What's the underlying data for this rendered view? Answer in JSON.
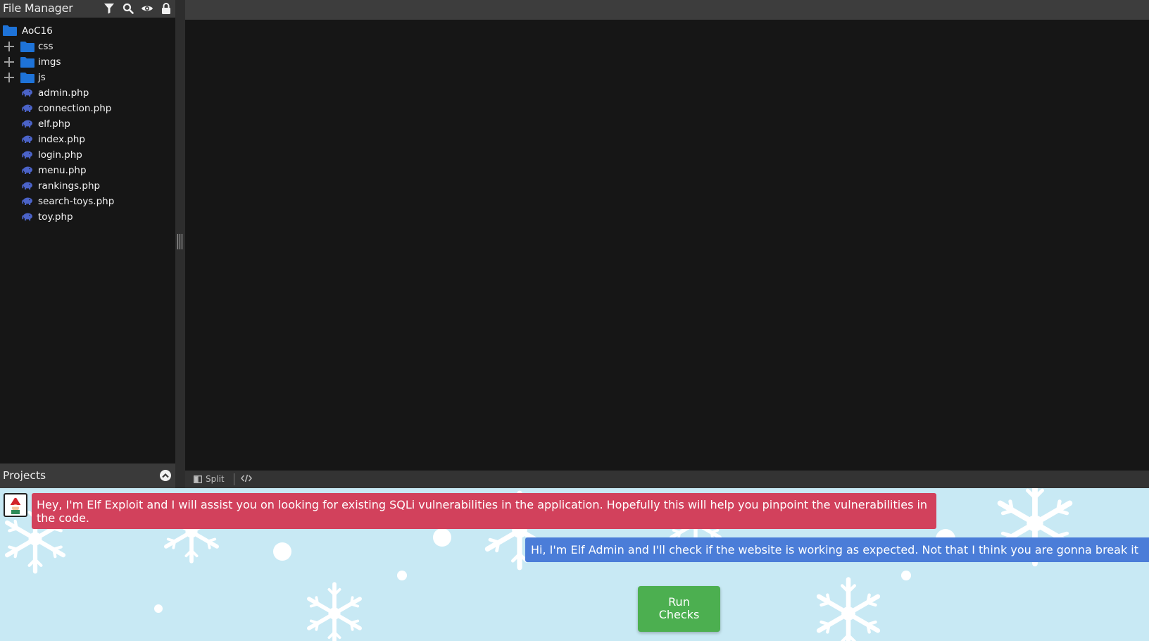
{
  "sidebar": {
    "title": "File Manager",
    "tools": [
      "filter-icon",
      "search-icon",
      "eye-icon",
      "lock-icon"
    ],
    "root": {
      "label": "AoC16",
      "icon": "folder-icon"
    },
    "folders": [
      {
        "label": "css",
        "icon": "folder-icon"
      },
      {
        "label": "imgs",
        "icon": "folder-icon"
      },
      {
        "label": "js",
        "icon": "folder-icon"
      }
    ],
    "files": [
      {
        "label": "admin.php",
        "icon": "php-icon"
      },
      {
        "label": "connection.php",
        "icon": "php-icon"
      },
      {
        "label": "elf.php",
        "icon": "php-icon"
      },
      {
        "label": "index.php",
        "icon": "php-icon"
      },
      {
        "label": "login.php",
        "icon": "php-icon"
      },
      {
        "label": "menu.php",
        "icon": "php-icon"
      },
      {
        "label": "rankings.php",
        "icon": "php-icon"
      },
      {
        "label": "search-toys.php",
        "icon": "php-icon"
      },
      {
        "label": "toy.php",
        "icon": "php-icon"
      }
    ],
    "projects_label": "Projects"
  },
  "statusbar": {
    "split_label": "Split"
  },
  "chat": {
    "exploit_message": "Hey, I'm Elf Exploit and I will assist you on looking for existing SQLi vulnerabilities in the application. Hopefully this will help you pinpoint the vulnerabilities in the code.",
    "admin_message": "Hi, I'm Elf Admin and I'll check if the website is working as expected. Not that I think you are gonna break it",
    "run_button_line1": "Run",
    "run_button_line2": "Checks"
  },
  "colors": {
    "folder": "#1e73d8",
    "php": "#4b63c8",
    "exploit_bubble": "#d2415c",
    "admin_bubble": "#4b7dd8",
    "run_button": "#4caf50",
    "chat_bg": "#c8e9f4"
  }
}
